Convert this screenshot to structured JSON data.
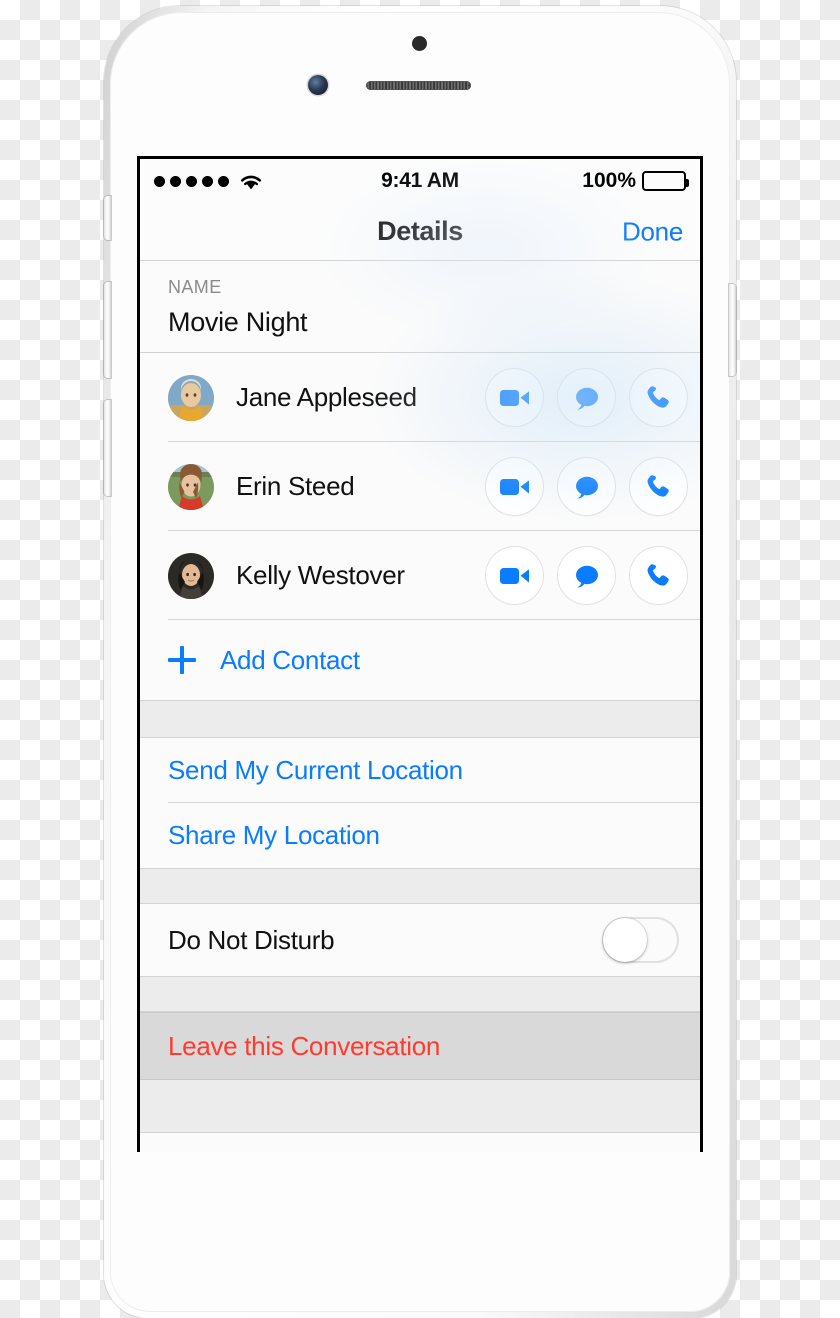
{
  "status_bar": {
    "signal_dots": 5,
    "signal_icon": "signal-dots-icon",
    "wifi_icon": "wifi-icon",
    "time": "9:41 AM",
    "battery_percent": "100%",
    "battery_icon": "battery-full-icon"
  },
  "nav_bar": {
    "title": "Details",
    "done_label": "Done"
  },
  "name_section": {
    "label": "NAME",
    "value": "Movie Night"
  },
  "contacts": {
    "items": [
      {
        "name": "Jane Appleseed",
        "avatar_name": "avatar-jane-appleseed",
        "actions": [
          {
            "icon": "video-camera-icon",
            "label": "FaceTime Video"
          },
          {
            "icon": "message-bubble-icon",
            "label": "Message"
          },
          {
            "icon": "phone-handset-icon",
            "label": "Call"
          }
        ]
      },
      {
        "name": "Erin Steed",
        "avatar_name": "avatar-erin-steed",
        "actions": [
          {
            "icon": "video-camera-icon",
            "label": "FaceTime Video"
          },
          {
            "icon": "message-bubble-icon",
            "label": "Message"
          },
          {
            "icon": "phone-handset-icon",
            "label": "Call"
          }
        ]
      },
      {
        "name": "Kelly Westover",
        "avatar_name": "avatar-kelly-westover",
        "actions": [
          {
            "icon": "video-camera-icon",
            "label": "FaceTime Video"
          },
          {
            "icon": "message-bubble-icon",
            "label": "Message"
          },
          {
            "icon": "phone-handset-icon",
            "label": "Call"
          }
        ]
      }
    ],
    "add_contact_label": "Add Contact",
    "add_contact_icon": "plus-icon"
  },
  "location_section": {
    "send_current_location": "Send My Current Location",
    "share_my_location": "Share My Location"
  },
  "dnd_section": {
    "label": "Do Not Disturb",
    "toggle_state": "off"
  },
  "leave_section": {
    "label": "Leave this Conversation"
  },
  "colors": {
    "accent_blue": "#0a7cff",
    "destructive_red": "#ff3b30",
    "row_background": "#fbfbfb",
    "gap_background": "#ececec",
    "highlighted_row": "#d9d9d9",
    "secondary_text": "#8b8b8b"
  },
  "device": {
    "hardware": {
      "sensor": "proximity-sensor",
      "camera": "front-camera",
      "speaker": "earpiece-speaker",
      "buttons": [
        "ring-silent-switch",
        "volume-up-button",
        "volume-down-button",
        "power-button"
      ]
    }
  }
}
